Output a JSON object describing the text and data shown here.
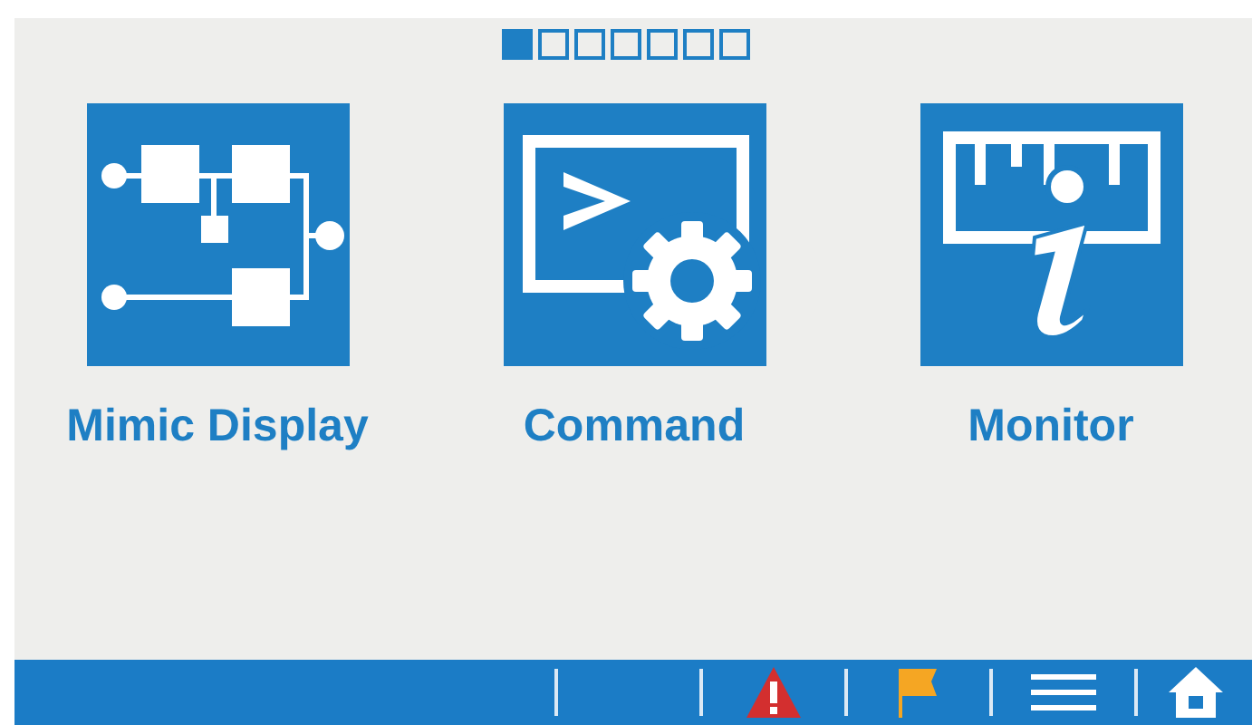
{
  "pager": [
    {
      "selected": true
    },
    {
      "selected": false
    },
    {
      "selected": false
    },
    {
      "selected": false
    },
    {
      "selected": false
    },
    {
      "selected": false
    },
    {
      "selected": false
    }
  ],
  "tiles": [
    {
      "kind": "mimic",
      "label": "Mimic Display"
    },
    {
      "kind": "command",
      "label": "Command"
    },
    {
      "kind": "monitor",
      "label": "Monitor"
    }
  ],
  "toolbar": [
    {
      "kind": "blank"
    },
    {
      "kind": "alert"
    },
    {
      "kind": "flag"
    },
    {
      "kind": "menu"
    },
    {
      "kind": "home"
    }
  ]
}
